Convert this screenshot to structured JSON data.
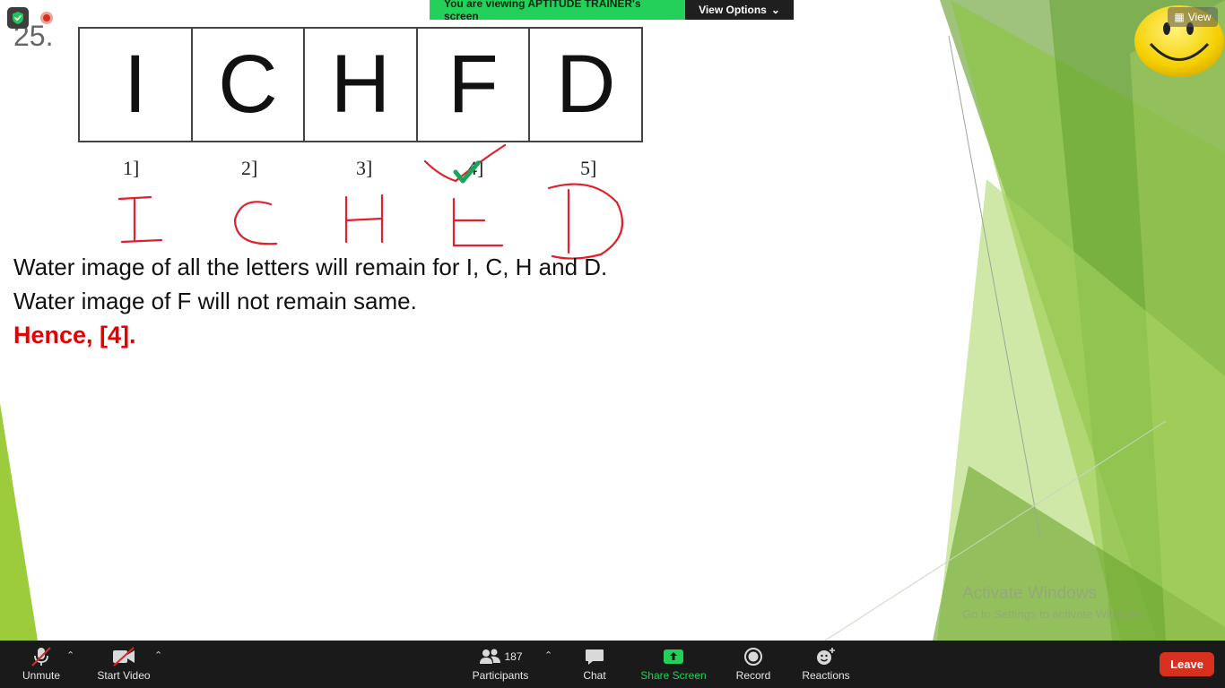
{
  "slide": {
    "question_number": "25.",
    "letters": [
      "I",
      "C",
      "H",
      "F",
      "D"
    ],
    "options": [
      "1]",
      "2]",
      "3]",
      "4]",
      "5]"
    ],
    "explanation_line1": "Water image of all the letters will remain for I, C, H and D.",
    "explanation_line2": "Water image of F will not remain same.",
    "answer": "Hence, [4]."
  },
  "share_banner": {
    "viewing_text": "You are viewing APTITUDE TRAINER's screen",
    "view_options_label": "View Options"
  },
  "view_button_label": "View",
  "watermark": {
    "line1": "Activate Windows",
    "line2": "Go to Settings to activate Windows."
  },
  "toolbar": {
    "unmute_label": "Unmute",
    "start_video_label": "Start Video",
    "participants_label": "Participants",
    "participants_count": "187",
    "chat_label": "Chat",
    "share_screen_label": "Share Screen",
    "record_label": "Record",
    "reactions_label": "Reactions",
    "leave_label": "Leave"
  },
  "colors": {
    "answer": "#e40000",
    "annotation_ink": "#e0202a",
    "check": "#1aa35a",
    "banner_green": "#23d05a",
    "toolbar_bg": "#1a1a1a",
    "leave_red": "#d7301f",
    "deco_green": "#8cc43c"
  }
}
